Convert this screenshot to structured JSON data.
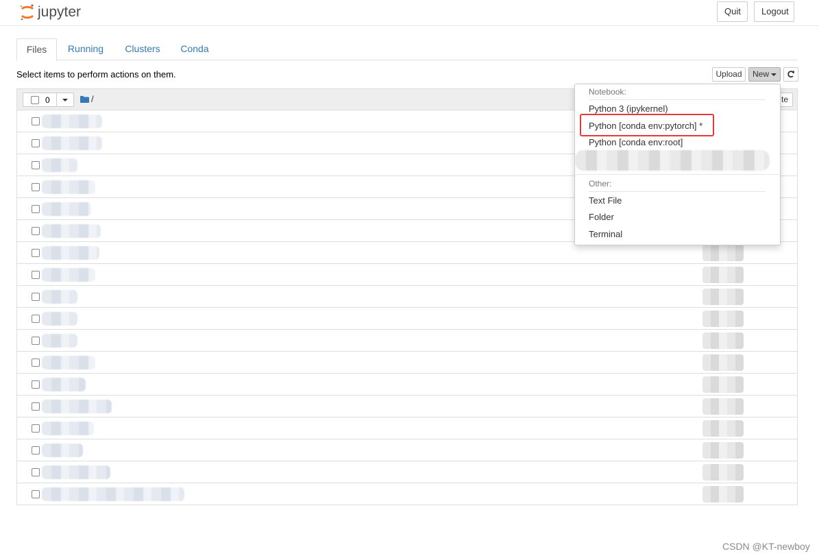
{
  "header": {
    "logo_text": "jupyter",
    "quit_label": "Quit",
    "logout_label": "Logout"
  },
  "tabs": [
    {
      "label": "Files",
      "active": true
    },
    {
      "label": "Running",
      "active": false
    },
    {
      "label": "Clusters",
      "active": false
    },
    {
      "label": "Conda",
      "active": false
    }
  ],
  "toolbar": {
    "select_message": "Select items to perform actions on them.",
    "upload_label": "Upload",
    "new_label": "New",
    "refresh_icon": "refresh-icon"
  },
  "file_list": {
    "selected_count": "0",
    "path": "/",
    "partial_button_text": "te",
    "row_count": 18
  },
  "new_menu": {
    "notebook_header": "Notebook:",
    "notebook_items": [
      "Python 3 (ipykernel)",
      "Python [conda env:pytorch] *",
      "Python [conda env:root]"
    ],
    "other_header": "Other:",
    "other_items": [
      "Text File",
      "Folder",
      "Terminal"
    ],
    "highlighted_item": "Python [conda env:pytorch] *",
    "highlight_color": "#e53935"
  },
  "colors": {
    "link": "#337ab7",
    "logo_orange": "#f37726"
  },
  "watermark": "CSDN @KT-newboy"
}
